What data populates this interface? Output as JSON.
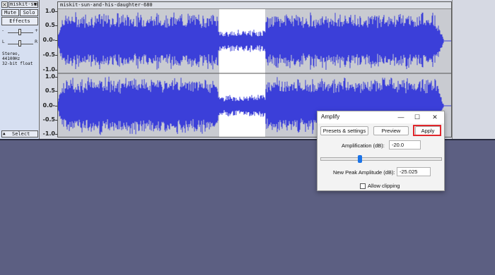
{
  "track": {
    "close_glyph": "×",
    "name": "miskit-sun",
    "dropdown_glyph": "▼",
    "mute_label": "Mute",
    "solo_label": "Solo",
    "effects_label": "Effects",
    "gain_minus": "-",
    "gain_plus": "+",
    "pan_left": "L",
    "pan_right": "R",
    "format_line1": "Stereo, 44100Hz",
    "format_line2": "32-bit float",
    "collapse_glyph": "▲",
    "select_label": "Select"
  },
  "ruler": {
    "labels": [
      "1.0",
      "0.5",
      "0.0-",
      "-0.5",
      "-1.0",
      "1.0",
      "0.5",
      "0.0-",
      "-0.5",
      "-1.0"
    ]
  },
  "clip": {
    "title": "miskit-sun-and-his-daughter-680",
    "wave_color": "#3b3fd9",
    "selection_color": "#ffffff"
  },
  "dialog": {
    "title": "Amplify",
    "minimize_glyph": "—",
    "maximize_glyph": "☐",
    "close_glyph": "✕",
    "presets_label": "Presets & settings",
    "preview_label": "Preview",
    "apply_label": "Apply",
    "amplification_label": "Amplification (dB):",
    "amplification_value": "-20.0",
    "peak_label": "New Peak Amplitude (dB):",
    "peak_value": "-25.025",
    "allow_clipping_label": "Allow clipping",
    "allow_clipping_checked": false,
    "slider_fraction": 0.32,
    "highlight_color": "#e0262b"
  }
}
